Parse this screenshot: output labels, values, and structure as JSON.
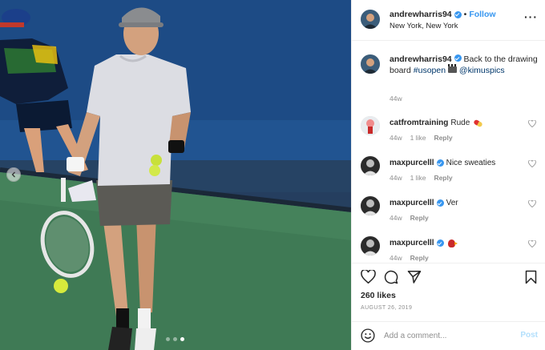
{
  "header": {
    "username": "andrewharris94",
    "bullet": "•",
    "follow_label": "Follow",
    "location": "New York, New York",
    "more_label": "···"
  },
  "caption": {
    "username": "andrewharris94",
    "text_before_tag": "Back to the drawing board",
    "hashtag": "#usopen",
    "mention": "@kimuspics",
    "time": "44w"
  },
  "comments": [
    {
      "username": "catfromtraining",
      "text": "Rude",
      "emoji": "pill-emoji",
      "verified": false,
      "time": "44w",
      "likes": "1 like",
      "reply": "Reply"
    },
    {
      "username": "maxpurcelll",
      "text": "Nice sweaties",
      "emoji": "",
      "verified": true,
      "time": "44w",
      "likes": "1 like",
      "reply": "Reply"
    },
    {
      "username": "maxpurcelll",
      "text": "Ver",
      "emoji": "",
      "verified": true,
      "time": "44w",
      "likes": "",
      "reply": "Reply"
    },
    {
      "username": "maxpurcelll",
      "text": "",
      "emoji": "cardinal-emoji",
      "verified": true,
      "time": "44w",
      "likes": "",
      "reply": "Reply"
    }
  ],
  "actions": {
    "likes": "260 likes",
    "date": "AUGUST 26, 2019"
  },
  "add_comment": {
    "placeholder": "Add a comment...",
    "post_label": "Post"
  },
  "carousel": {
    "slide_count": 3,
    "active_index": 2
  },
  "colors": {
    "link": "#3897f0",
    "tag": "#00376b",
    "muted": "#8e8e8e",
    "post_disabled": "#b2dffc"
  }
}
